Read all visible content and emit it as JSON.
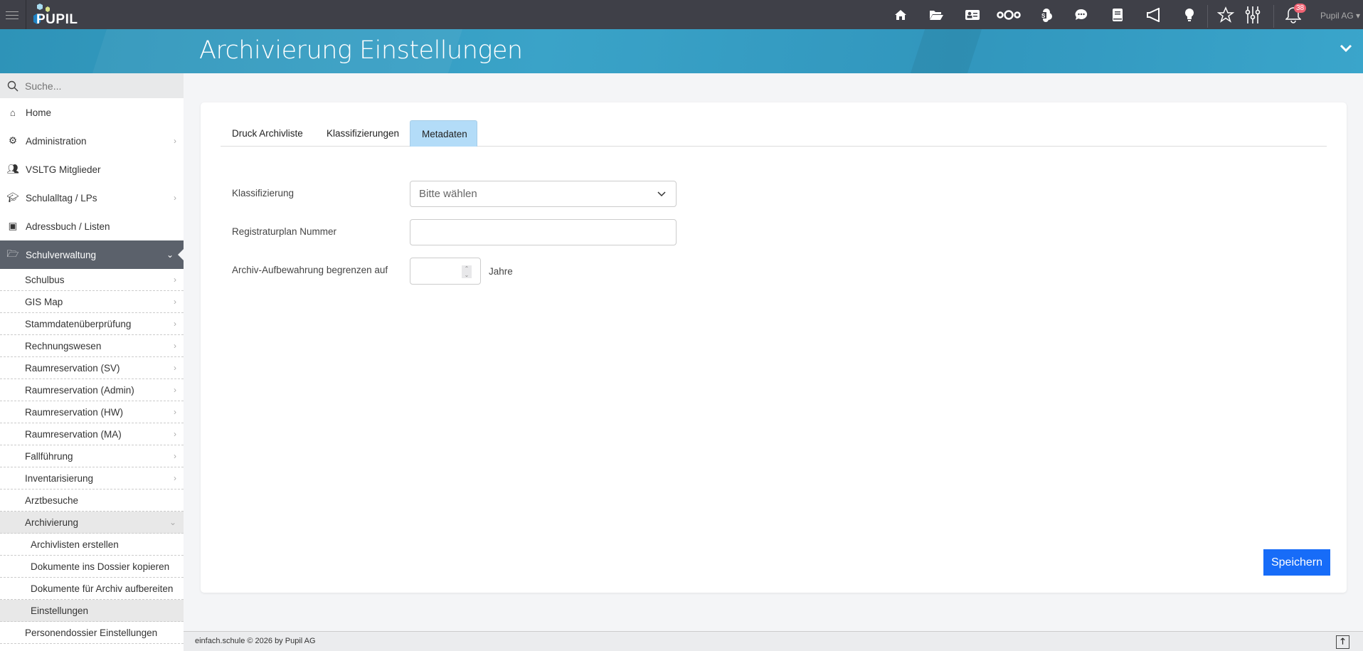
{
  "app": {
    "logo": "PUPIL",
    "user": "Pupil AG",
    "notifications": "38"
  },
  "topbar_icons": [
    "home-icon",
    "folder-icon",
    "address-card-icon",
    "nextcloud-icon",
    "sharepoint-icon",
    "chat-icon",
    "book-icon",
    "megaphone-icon",
    "lightbulb-icon",
    "star-icon",
    "sliders-icon",
    "bell-icon"
  ],
  "header": {
    "title": "Archivierung Einstellungen"
  },
  "sidebar": {
    "search_placeholder": "Suche...",
    "items": [
      {
        "label": "Home"
      },
      {
        "label": "Administration"
      },
      {
        "label": "VSLTG Mitglieder"
      },
      {
        "label": "Schulalltag / LPs"
      },
      {
        "label": "Adressbuch / Listen"
      },
      {
        "label": "Schulverwaltung"
      }
    ],
    "sub": [
      {
        "label": "Schulbus"
      },
      {
        "label": "GIS Map"
      },
      {
        "label": "Stammdatenüberprüfung"
      },
      {
        "label": "Rechnungswesen"
      },
      {
        "label": "Raumreservation (SV)"
      },
      {
        "label": "Raumreservation (Admin)"
      },
      {
        "label": "Raumreservation (HW)"
      },
      {
        "label": "Raumreservation (MA)"
      },
      {
        "label": "Fallführung"
      },
      {
        "label": "Inventarisierung"
      },
      {
        "label": "Arztbesuche"
      },
      {
        "label": "Archivierung"
      }
    ],
    "subsub": [
      {
        "label": "Archivlisten erstellen"
      },
      {
        "label": "Dokumente ins Dossier kopieren"
      },
      {
        "label": "Dokumente für Archiv aufbereiten"
      },
      {
        "label": "Einstellungen"
      }
    ],
    "last": "Personendossier Einstellungen"
  },
  "tabs": [
    {
      "label": "Druck Archivliste"
    },
    {
      "label": "Klassifizierungen"
    },
    {
      "label": "Metadaten"
    }
  ],
  "form": {
    "klass_label": "Klassifizierung",
    "klass_value": "Bitte wählen",
    "reg_label": "Registraturplan Nummer",
    "reg_value": "",
    "aufb_label": "Archiv-Aufbewahrung begrenzen auf",
    "aufb_value": "",
    "aufb_unit": "Jahre",
    "save": "Speichern"
  },
  "footer": {
    "text": "einfach.schule © 2026 by Pupil AG"
  },
  "colors": {
    "topbar": "#3f4048",
    "banner": "#3196bd",
    "active_tab": "#b3dcf8",
    "primary": "#176cf8"
  }
}
